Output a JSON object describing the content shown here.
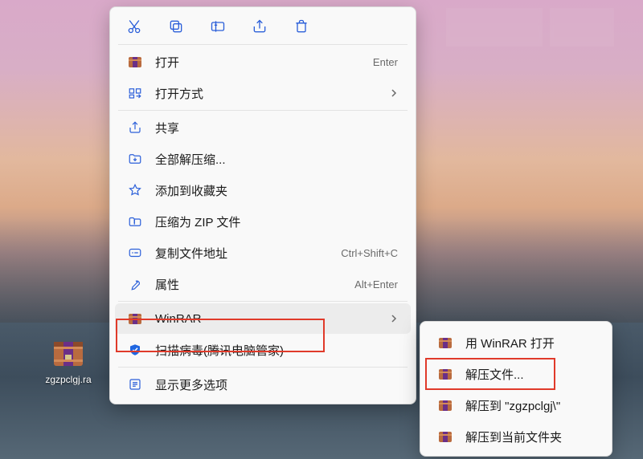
{
  "desktop_file": {
    "name": "zgzpclgj.ra"
  },
  "toolbar": {
    "cut": "cut-icon",
    "copy": "copy-icon",
    "rename": "rename-icon",
    "share": "share-icon",
    "delete": "delete-icon"
  },
  "menu": {
    "open": {
      "label": "打开",
      "shortcut": "Enter"
    },
    "open_with": {
      "label": "打开方式",
      "submenu": true
    },
    "share": {
      "label": "共享"
    },
    "extract_all": {
      "label": "全部解压缩..."
    },
    "favorite": {
      "label": "添加到收藏夹"
    },
    "zip": {
      "label": "压缩为 ZIP 文件"
    },
    "copy_path": {
      "label": "复制文件地址",
      "shortcut": "Ctrl+Shift+C"
    },
    "properties": {
      "label": "属性",
      "shortcut": "Alt+Enter"
    },
    "winrar": {
      "label": "WinRAR",
      "submenu": true
    },
    "scan": {
      "label": "扫描病毒(腾讯电脑管家)"
    },
    "more": {
      "label": "显示更多选项"
    }
  },
  "submenu": {
    "open_with_winrar": {
      "label": "用 WinRAR 打开"
    },
    "extract_files": {
      "label": "解压文件..."
    },
    "extract_to_named": {
      "label": "解压到 \"zgzpclgj\\\""
    },
    "extract_here": {
      "label": "解压到当前文件夹"
    }
  }
}
